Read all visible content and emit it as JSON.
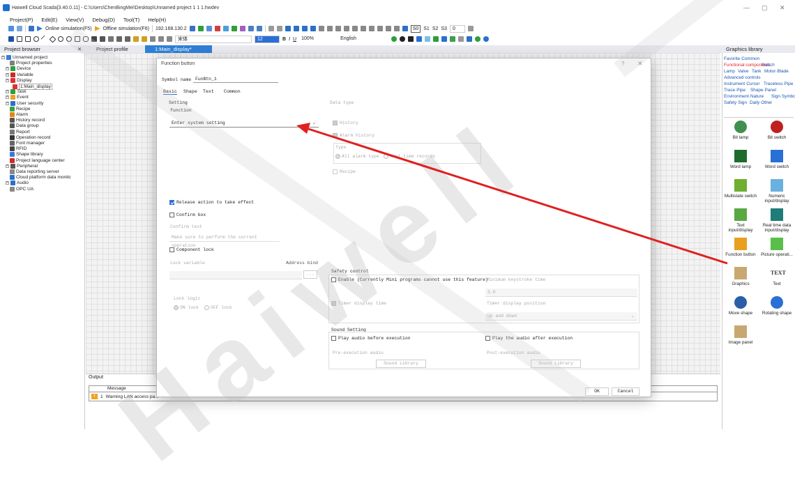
{
  "window": {
    "title": "Haiwell Cloud Scada[3.40.0.11] - C:\\Users\\ChenBingMei\\Desktop\\Unnamed project 1 1 1.hwdev",
    "minimize": "—",
    "restore": "▢",
    "close": "✕"
  },
  "menu": [
    "Project(P)",
    "Edit(E)",
    "View(V)",
    "Debug(D)",
    "Tool(T)",
    "Help(H)"
  ],
  "toolbar": {
    "online_sim": "Online simulation(F5)",
    "offline_sim": "Offline simulation(F6)",
    "ip": "192.168.130.2",
    "font": "宋体",
    "font_size": "12",
    "bold": "B",
    "italic": "I",
    "underline": "U",
    "zoom": "100%",
    "language": "English",
    "s0": "S0",
    "s1": "S1",
    "s2": "S2",
    "s3": "S3",
    "state_value": "0"
  },
  "tabs": {
    "project_browser": "Project browser",
    "project_profile": "Project profile",
    "main_display": "1:Main_display*",
    "graphics_library": "Graphics library"
  },
  "tree": [
    {
      "label": "Unnamed project",
      "color": "#3a7bd5"
    },
    {
      "label": "Project properties",
      "color": "#808080"
    },
    {
      "label": "Device",
      "color": "#2e9e3e"
    },
    {
      "label": "Variable",
      "color": "#d02828"
    },
    {
      "label": "Display",
      "color": "#e03030"
    },
    {
      "label": "1:Main_display",
      "color": "#e03030"
    },
    {
      "label": "Task",
      "color": "#2e9e3e"
    },
    {
      "label": "Event",
      "color": "#f0a020"
    },
    {
      "label": "User security",
      "color": "#2a70c8"
    },
    {
      "label": "Recipe",
      "color": "#3aa04a"
    },
    {
      "label": "Alarm",
      "color": "#e08a10"
    },
    {
      "label": "History record",
      "color": "#555555"
    },
    {
      "label": "Data group",
      "color": "#555555"
    },
    {
      "label": "Report",
      "color": "#777777"
    },
    {
      "label": "Operation record",
      "color": "#333333"
    },
    {
      "label": "Font manager",
      "color": "#666666"
    },
    {
      "label": "RFID",
      "color": "#444444"
    },
    {
      "label": "Shape library",
      "color": "#3a7bd5"
    },
    {
      "label": "Project language center",
      "color": "#d02828"
    },
    {
      "label": "Peripheral",
      "color": "#555555"
    },
    {
      "label": "Data reporting server",
      "color": "#888888"
    },
    {
      "label": "Cloud platform data monitc",
      "color": "#2a70c8"
    },
    {
      "label": "Audio",
      "color": "#2a70c8"
    },
    {
      "label": "OPC UA",
      "color": "#888888"
    }
  ],
  "output": {
    "title": "Output",
    "column": "Message",
    "rows": [
      {
        "index": "1",
        "message": "Warning  LAN access pa..."
      }
    ]
  },
  "graphics_library": {
    "categories": [
      {
        "label": "Favorite·Common",
        "active": false
      },
      {
        "label": "Functional components",
        "active": true
      },
      {
        "label": "Switch",
        "active": false
      },
      {
        "label": "Lamp",
        "active": false
      },
      {
        "label": "Valve",
        "active": false
      },
      {
        "label": "Tank",
        "active": false
      },
      {
        "label": "Motor·Blade",
        "active": false
      },
      {
        "label": "Advanced controls",
        "active": false
      },
      {
        "label": "Instrument·Cursor",
        "active": false
      },
      {
        "label": "Traceless·Pipe",
        "active": false
      },
      {
        "label": "Trace·Pipe",
        "active": false
      },
      {
        "label": "Shape·Panel",
        "active": false
      },
      {
        "label": "Environment·Nature",
        "active": false
      },
      {
        "label": "Sign·Symbol",
        "active": false
      },
      {
        "label": "Safety·Sign",
        "active": false
      },
      {
        "label": "Daily·Other",
        "active": false
      }
    ],
    "components": [
      {
        "label": "Bit lamp",
        "icon": "bit-lamp-icon",
        "color": "#3f8f4f"
      },
      {
        "label": "Bit switch",
        "icon": "bit-switch-icon",
        "color": "#c02020"
      },
      {
        "label": "Word lamp",
        "icon": "word-lamp-icon",
        "color": "#1e6b2e"
      },
      {
        "label": "Word switch",
        "icon": "word-switch-icon",
        "color": "#2a6fd6"
      },
      {
        "label": "Multistate switch",
        "icon": "multistate-switch-icon",
        "color": "#6fae2f"
      },
      {
        "label": "Numeric input/display",
        "icon": "numeric-display-icon",
        "color": "#6ab0e0"
      },
      {
        "label": "Text input/display",
        "icon": "text-display-icon",
        "color": "#5aa843"
      },
      {
        "label": "Real time data input/display",
        "icon": "realtime-data-icon",
        "color": "#1e7d78"
      },
      {
        "label": "Function button",
        "icon": "function-button-icon",
        "color": "#e8a020"
      },
      {
        "label": "Picture operati...",
        "icon": "picture-operation-icon",
        "color": "#5abf4a"
      },
      {
        "label": "Graphics",
        "icon": "graphics-icon",
        "color": "#c8a870"
      },
      {
        "label": "Text",
        "icon": "text-icon",
        "color": "#333333",
        "glyph": "TEXT"
      },
      {
        "label": "Move shape",
        "icon": "move-shape-icon",
        "color": "#2a5fa8"
      },
      {
        "label": "Rotating shape",
        "icon": "rotating-shape-icon",
        "color": "#2a6fd6"
      },
      {
        "label": "Image panel",
        "icon": "image-panel-icon",
        "color": "#c8a870"
      }
    ]
  },
  "dialog": {
    "title": "Function button",
    "help": "?",
    "close": "✕",
    "symbol_name_label": "Symbol name",
    "symbol_name_value": "FunBtn_1",
    "tabs": [
      "Basic",
      "Shape",
      "Text",
      "Common"
    ],
    "setting_label": "Setting",
    "function_label": "function",
    "function_value": "Enter system setting",
    "release_action": "Release action to take effect",
    "confirm_box": "Confirm box",
    "confirm_text_label": "Confirm text",
    "confirm_text_value": "Make sure to perform the current operation",
    "component_lock": "Component lock",
    "lock_variable": "Lock variable",
    "address_bind": "Address bind",
    "browse": "...",
    "lock_logic": "Lock logic",
    "on_lock": "ON lock",
    "off_lock": "OFF lock",
    "data_type": "Data type",
    "history": "History",
    "alarm_history": "Alarm history",
    "type_label": "Type",
    "all_alarm_type": "All alarm type",
    "real_time_records": "Real-time records",
    "recipe": "Recipe",
    "safety_control": "Safety control",
    "enable": "Enable (Currently Mini programs cannot use this feature)",
    "min_keystroke_label": "Minimum keystroke time",
    "min_keystroke_value": "3.0",
    "timer_display_time": "Timer display time",
    "timer_display_position_label": "Timer display position",
    "timer_display_position_value": "Up and down",
    "sound_setting": "Sound Setting",
    "play_before": "Play audio before execution",
    "play_after": "Play the audio after execution",
    "pre_audio": "Pre-execution audio",
    "post_audio": "Post-execution audio",
    "sound_library": "Sound Library",
    "ok": "OK",
    "cancel": "Cancel"
  },
  "watermark": "Haiwell",
  "annotation_arrow_color": "#e02020"
}
